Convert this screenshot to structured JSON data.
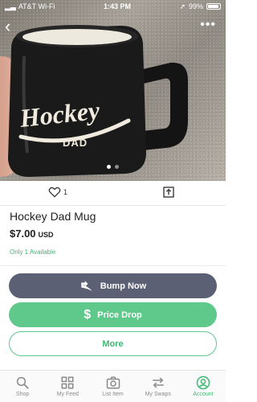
{
  "status_bar": {
    "carrier": "AT&T Wi-Fi",
    "time": "1:43 PM",
    "battery": "99%"
  },
  "listing": {
    "mug_text_top": "Hockey",
    "mug_text_bottom": "DAD",
    "likes": "1",
    "title": "Hockey Dad Mug",
    "price": "$7.00",
    "currency": "USD",
    "availability": "Only 1 Available",
    "image_page": 1,
    "image_count": 2
  },
  "buttons": {
    "bump": "Bump Now",
    "price_drop": "Price Drop",
    "more": "More"
  },
  "tabs": [
    {
      "label": "Shop",
      "icon": "search-icon"
    },
    {
      "label": "My Feed",
      "icon": "grid-icon"
    },
    {
      "label": "List Item",
      "icon": "camera-icon"
    },
    {
      "label": "My Swaps",
      "icon": "swap-icon"
    },
    {
      "label": "Account",
      "icon": "account-icon",
      "active": true
    }
  ],
  "colors": {
    "accent_green": "#5ec98a",
    "bump_gray": "#5b6074",
    "text_green": "#3fb873"
  }
}
